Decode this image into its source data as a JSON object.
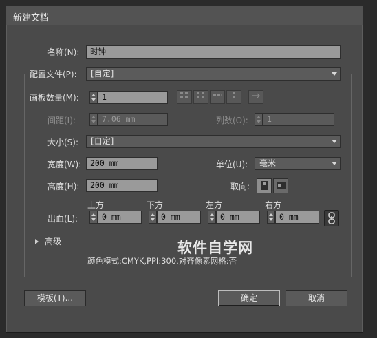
{
  "dialog": {
    "title": "新建文档",
    "name_label": "名称(N):",
    "name_value": "时钟",
    "profile_label": "配置文件(P):",
    "profile_value": "[自定]",
    "artboards_label": "画板数量(M):",
    "artboards_value": "1",
    "spacing_label": "间距(I):",
    "spacing_value": "7.06 mm",
    "columns_label": "列数(O):",
    "columns_value": "1",
    "size_label": "大小(S):",
    "size_value": "[自定]",
    "width_label": "宽度(W):",
    "width_value": "200 mm",
    "units_label": "单位(U):",
    "units_value": "毫米",
    "height_label": "高度(H):",
    "height_value": "200 mm",
    "orientation_label": "取向:",
    "bleed_label": "出血(L):",
    "bleed": {
      "top_label": "上方",
      "top_value": "0 mm",
      "bottom_label": "下方",
      "bottom_value": "0 mm",
      "left_label": "左方",
      "left_value": "0 mm",
      "right_label": "右方",
      "right_value": "0 mm"
    },
    "advanced_label": "高级",
    "summary": "颜色模式:CMYK,PPI:300,对齐像素网格:否",
    "templates_button": "模板(T)...",
    "ok_button": "确定",
    "cancel_button": "取消"
  },
  "watermark": "软件自学网",
  "icons": {
    "artboard_layout": [
      "grid-by-row-icon",
      "grid-by-column-icon",
      "arrange-by-row-icon",
      "arrange-by-column-icon",
      "right-to-left-icon"
    ],
    "orientation": [
      "portrait-icon",
      "landscape-icon"
    ],
    "bleed_link": "chain-link-icon"
  },
  "colors": {
    "dialog_bg": "#4a4a4a",
    "field_bg": "#9a9a9a",
    "select_bg": "#5b5b5b"
  }
}
